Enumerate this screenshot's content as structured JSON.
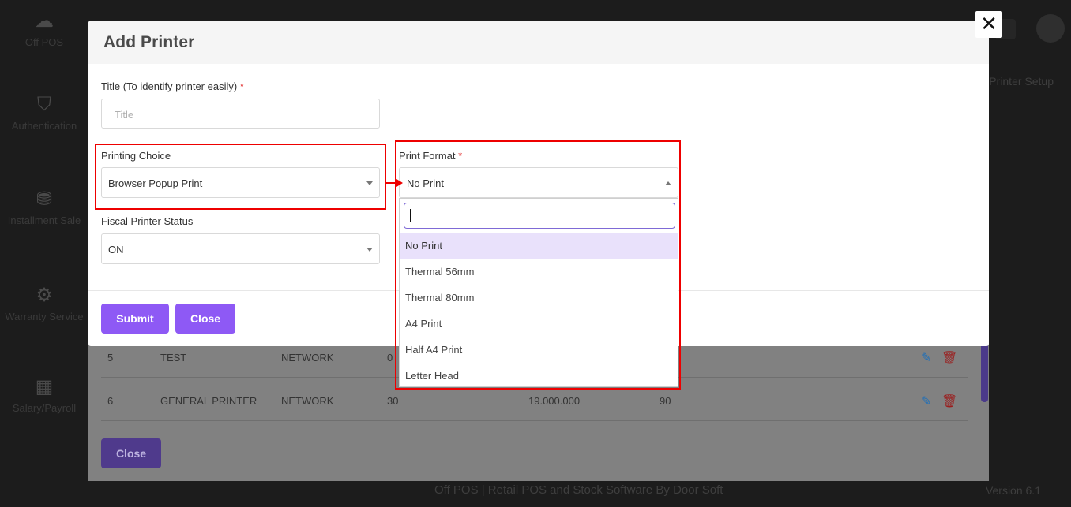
{
  "background": {
    "logo_text": "Off POS",
    "sidebar": [
      "Authentication",
      "Installment Sale",
      "Warranty Service",
      "Salary/Payroll"
    ],
    "header_right": "Printer Setup",
    "footer": "Off POS | Retail POS and Stock Software By Door Soft",
    "version": "Version 6.1",
    "table_rows": [
      {
        "no": "5",
        "name": "TEST",
        "type": "NETWORK",
        "port": "0",
        "ip": "",
        "chars": ""
      },
      {
        "no": "6",
        "name": "GENERAL PRINTER",
        "type": "NETWORK",
        "port": "30",
        "ip": "19.000.000",
        "chars": "90"
      }
    ],
    "close_button": "Close"
  },
  "modal": {
    "title": "Add Printer",
    "title_field": {
      "label": "Title (To identify printer easily)",
      "required_mark": "*",
      "placeholder": "Title"
    },
    "printing_choice": {
      "label": "Printing Choice",
      "value": "Browser Popup Print"
    },
    "fiscal_status": {
      "label": "Fiscal Printer Status",
      "value": "ON"
    },
    "print_format": {
      "label": "Print Format",
      "required_mark": "*",
      "value": "No Print"
    },
    "submit_label": "Submit",
    "close_label": "Close"
  },
  "dropdown": {
    "search_value": "",
    "options": [
      "No Print",
      "Thermal 56mm",
      "Thermal 80mm",
      "A4 Print",
      "Half A4 Print",
      "Letter Head"
    ],
    "selected": "No Print"
  },
  "close_icon_glyph": "✕"
}
